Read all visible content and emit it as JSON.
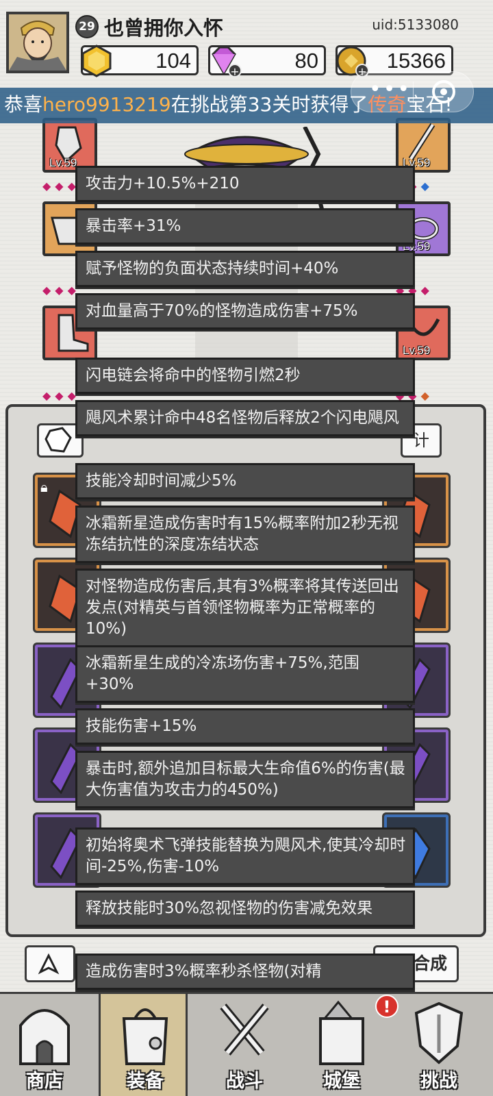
{
  "player": {
    "level": "29",
    "name": "也曾拥你入怀",
    "uid": "uid:5133080"
  },
  "resources": [
    {
      "name": "gold-hexagon",
      "value": "104",
      "color": "#f2c12e"
    },
    {
      "name": "purple-gem",
      "value": "80",
      "color": "#c35ad6"
    },
    {
      "name": "coin",
      "value": "15366",
      "color": "#d9a42b"
    }
  ],
  "announcement": {
    "prefix": "恭喜",
    "player": "hero9913219",
    "middle": "在挑战第33关时获得了",
    "rarity": "传奇",
    "suffix": "宝石!"
  },
  "equipment": {
    "slots": [
      {
        "side": "left",
        "lv": "Lv.59",
        "color": "red"
      },
      {
        "side": "right",
        "lv": "Lv.59",
        "color": "orange"
      },
      {
        "side": "left",
        "lv": "",
        "color": "orange"
      },
      {
        "side": "right",
        "lv": "Lv.59",
        "color": "purple"
      },
      {
        "side": "left",
        "lv": "",
        "color": "red"
      },
      {
        "side": "right",
        "lv": "Lv.59",
        "color": "red"
      }
    ]
  },
  "panel": {
    "stat_button": "计",
    "merge_button": "合成"
  },
  "tooltip": {
    "lines": [
      "攻击力+10.5%+210",
      "暴击率+31%",
      "赋予怪物的负面状态持续时间+40%",
      "对血量高于70%的怪物造成伤害+75%",
      "闪电链会将命中的怪物引燃2秒",
      "飓风术累计命中48名怪物后释放2个闪电飓风",
      "技能冷却时间减少5%",
      "冰霜新星造成伤害时有15%概率附加2秒无视冻结抗性的深度冻结状态",
      "对怪物造成伤害后,其有3%概率将其传送回出发点(对精英与首领怪物概率为正常概率的10%)",
      "冰霜新星生成的冷冻场伤害+75%,范围+30%",
      "技能伤害+15%",
      "暴击时,额外追加目标最大生命值6%的伤害(最大伤害值为攻击力的450%)",
      "初始将奥术飞弹技能替换为飓风术,使其冷却时间-25%,伤害-10%",
      "释放技能时30%忽视怪物的伤害减免效果",
      "造成伤害时3%概率秒杀怪物(对精"
    ]
  },
  "nav": {
    "items": [
      {
        "label": "商店",
        "icon": "shop-icon"
      },
      {
        "label": "装备",
        "icon": "backpack-icon"
      },
      {
        "label": "战斗",
        "icon": "crossed-swords-icon"
      },
      {
        "label": "城堡",
        "icon": "castle-icon"
      },
      {
        "label": "挑战",
        "icon": "shield-icon"
      }
    ],
    "alert": "!"
  }
}
